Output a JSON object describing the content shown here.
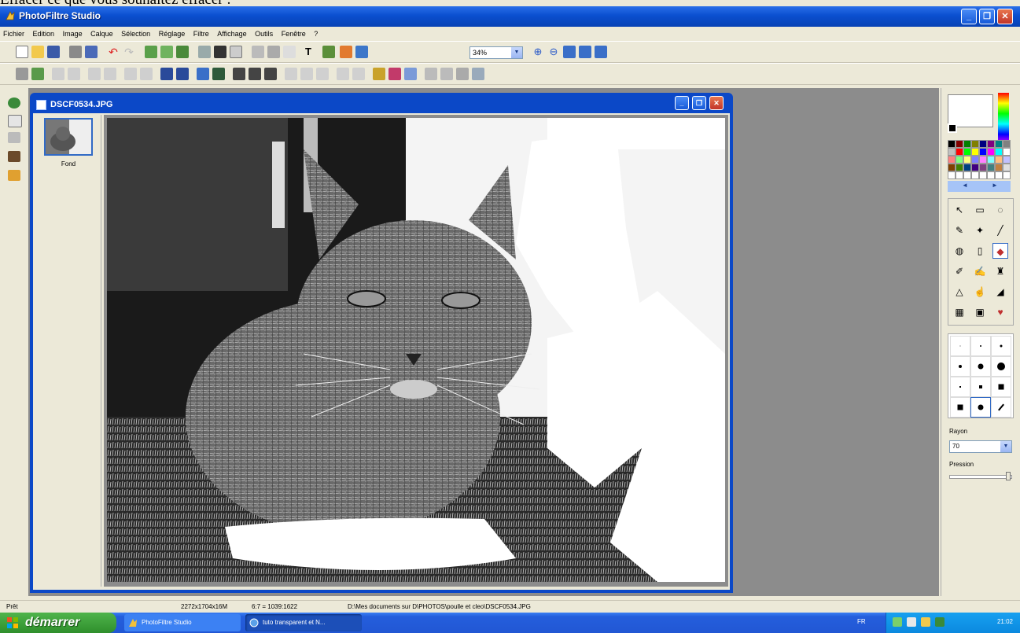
{
  "caption": "Effacer ce que vous souhaitez effacer :",
  "app": {
    "title": "PhotoFiltre Studio",
    "minimize_label": "_",
    "maximize_label": "❐",
    "close_label": "✕"
  },
  "menu": [
    "Fichier",
    "Edition",
    "Image",
    "Calque",
    "Sélection",
    "Réglage",
    "Filtre",
    "Affichage",
    "Outils",
    "Fenêtre",
    "?"
  ],
  "toolbar": {
    "zoom_value": "34%",
    "text_tool_label": "T"
  },
  "document": {
    "title": "DSCF0534.JPG",
    "layer_label": "Fond"
  },
  "right_panel": {
    "rayon_label": "Rayon",
    "rayon_value": "70",
    "pression_label": "Pression",
    "palette_prev": "◄",
    "palette_next": "►",
    "pression_level": 1.0
  },
  "status": {
    "ready": "Prêt",
    "size": "2272x1704x16M",
    "ratio": "6:7 = 1039:1622",
    "path": "D:\\Mes documents sur D\\PHOTOS\\poulle et cleo\\DSCF0534.JPG"
  },
  "taskbar": {
    "start_label": "démarrer",
    "task1": "PhotoFiltre Studio",
    "task2": "tuto transparent et N...",
    "lang": "FR",
    "clock": "21:02"
  },
  "colors": {
    "xp_blue": "#0b48c7",
    "workspace": "#8c8c8c",
    "chrome": "#ece9d8"
  }
}
